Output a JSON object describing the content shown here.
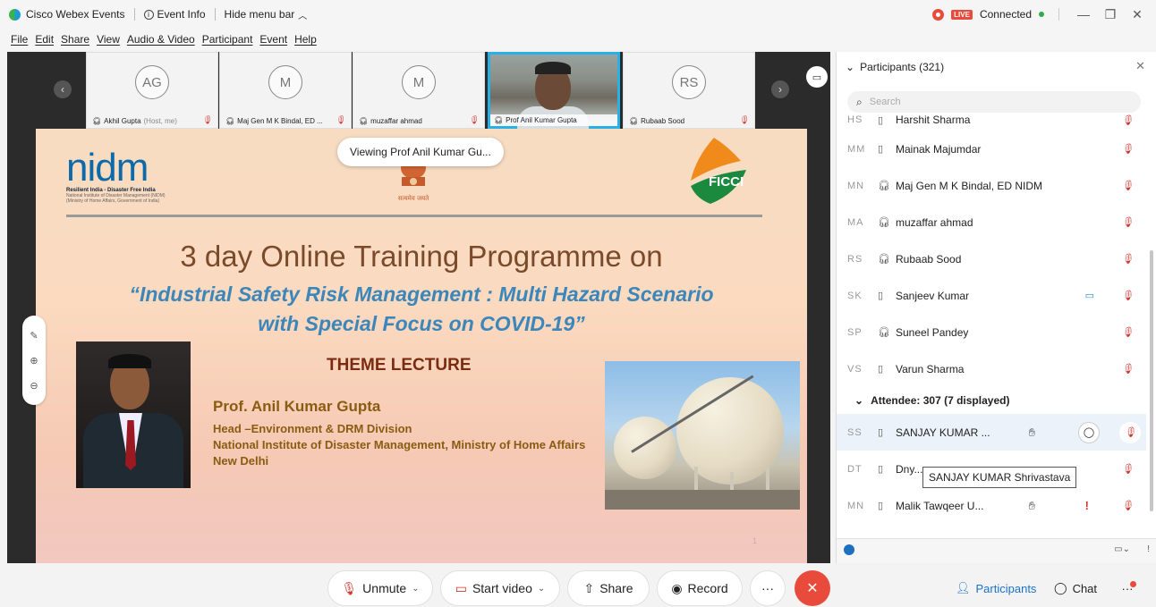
{
  "titlebar": {
    "app_name": "Cisco Webex Events",
    "event_info": "Event Info",
    "hide_menu": "Hide menu bar",
    "live": "LIVE",
    "status": "Connected"
  },
  "menu": [
    "File",
    "Edit",
    "Share",
    "View",
    "Audio & Video",
    "Participant",
    "Event",
    "Help"
  ],
  "filmstrip": [
    {
      "initials": "AG",
      "name": "Akhil Gupta",
      "role": "(Host, me)"
    },
    {
      "initials": "M",
      "name": "Maj Gen M K Bindal, ED ...",
      "role": ""
    },
    {
      "initials": "M",
      "name": "muzaffar ahmad",
      "role": ""
    },
    {
      "initials": "",
      "name": "Prof Anil Kumar Gupta",
      "role": ""
    },
    {
      "initials": "RS",
      "name": "Rubaab Sood",
      "role": ""
    }
  ],
  "viewing": "Viewing Prof Anil Kumar Gu...",
  "slide": {
    "logo_text": "nidm",
    "logo_sub": "Resilient India - Disaster Free India",
    "logo_sub2": "National Institute of Disaster Management (NIDM)",
    "logo_sub3": "(Ministry of Home Affairs, Government of India)",
    "emblem_text": "सत्यमेव जयते",
    "ficci": "FICCI",
    "title": "3 day Online Training Programme on",
    "subtitle1": "“Industrial Safety Risk Management : Multi Hazard Scenario",
    "subtitle2": "with Special Focus on COVID-19”",
    "theme": "THEME LECTURE",
    "speaker": "Prof. Anil Kumar Gupta",
    "line1": "Head –Environment & DRM Division",
    "line2": "National Institute of Disaster Management, Ministry of Home Affairs",
    "line3": "New Delhi",
    "page": "1"
  },
  "panel": {
    "title": "Participants (321)",
    "search_placeholder": "Search",
    "participants": [
      {
        "initials": "HS",
        "name": "Harshit Sharma",
        "device": "phone"
      },
      {
        "initials": "MM",
        "name": "Mainak Majumdar",
        "device": "phone"
      },
      {
        "initials": "MN",
        "name": "Maj Gen M K Bindal, ED NIDM",
        "device": "headset"
      },
      {
        "initials": "MA",
        "name": "muzaffar ahmad",
        "device": "headset"
      },
      {
        "initials": "RS",
        "name": "Rubaab Sood",
        "device": "headset"
      },
      {
        "initials": "SK",
        "name": "Sanjeev Kumar",
        "device": "phone",
        "video": true
      },
      {
        "initials": "SP",
        "name": "Suneel Pandey",
        "device": "headset"
      },
      {
        "initials": "VS",
        "name": "Varun Sharma",
        "device": "phone"
      }
    ],
    "attendee_header": "Attendee: 307 (7 displayed)",
    "attendees": [
      {
        "initials": "SS",
        "name": "SANJAY KUMAR ...",
        "hand": true,
        "selected": true
      },
      {
        "initials": "DT",
        "name": "Dny...",
        "hand": false
      },
      {
        "initials": "MN",
        "name": "Malik Tawqeer U...",
        "hand": true,
        "alert": true
      }
    ],
    "tooltip": "SANJAY KUMAR Shrivastava"
  },
  "controls": {
    "unmute": "Unmute",
    "start_video": "Start video",
    "share": "Share",
    "record": "Record",
    "more": "···",
    "participants": "Participants",
    "chat": "Chat"
  }
}
